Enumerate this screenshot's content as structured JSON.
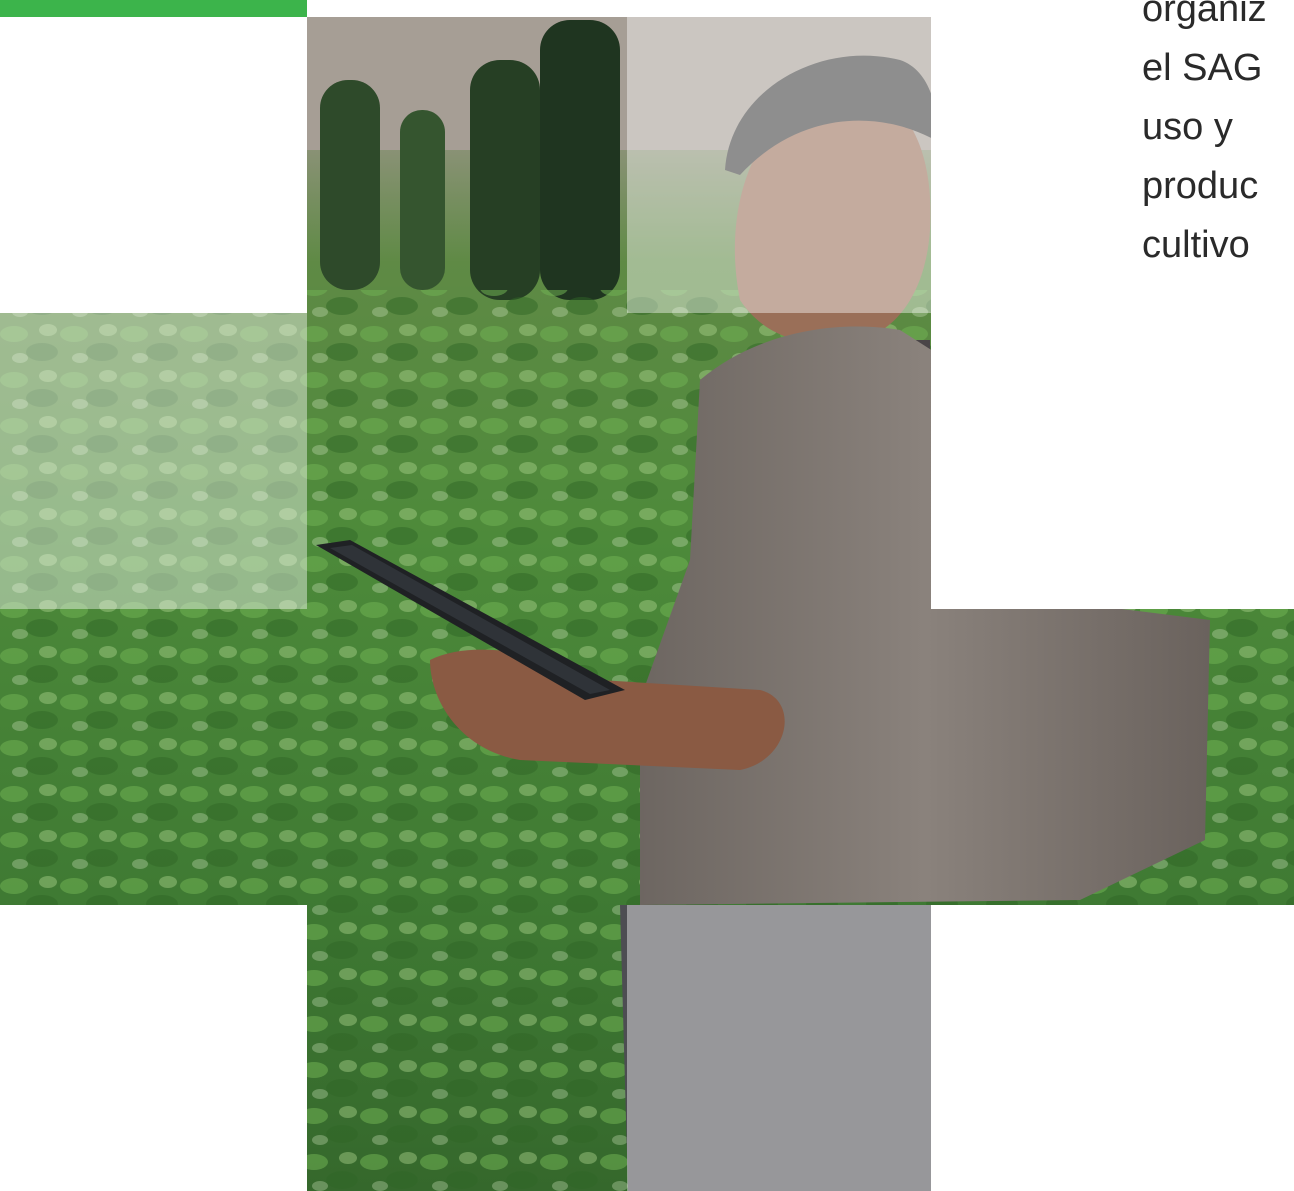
{
  "intro_text": {
    "lines": [
      "organiz",
      "el SAG",
      "uso y",
      "produc",
      "cultivo"
    ]
  },
  "photo": {
    "subject": "farmer-with-tablet-in-field"
  },
  "colors": {
    "accent": "#3cb44b",
    "foliage": "#4d8a3a",
    "background": "#ffffff"
  }
}
